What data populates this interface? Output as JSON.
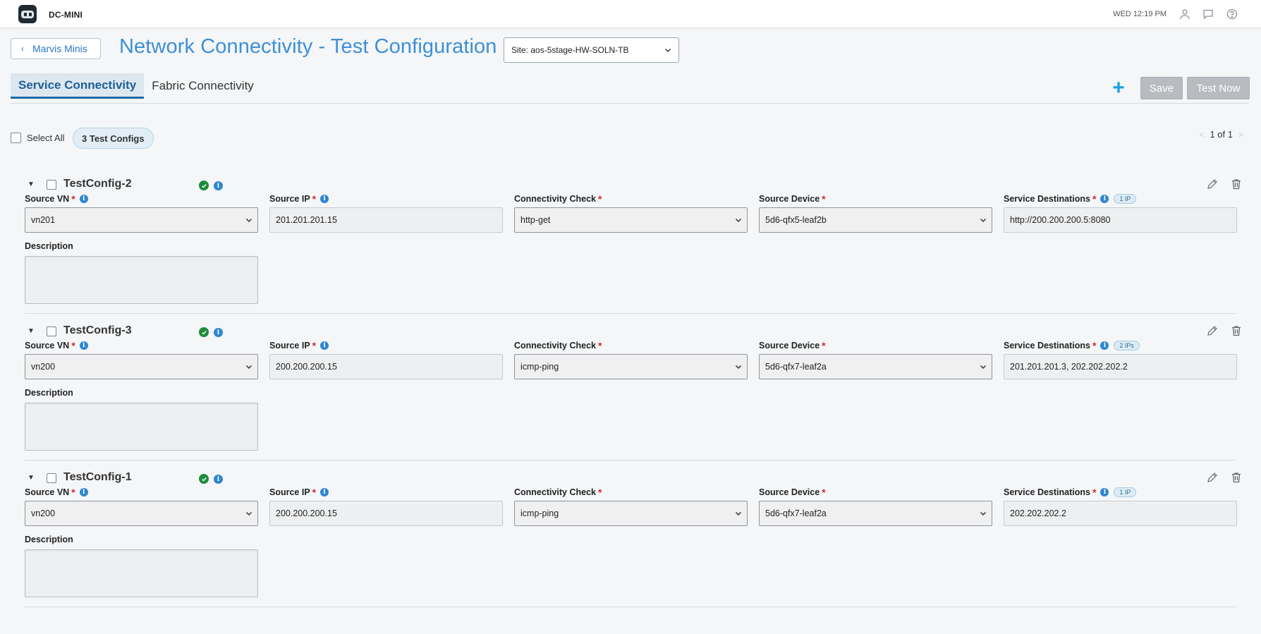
{
  "app": {
    "org_name": "DC-MINI",
    "clock": "WED 12:19 PM"
  },
  "header": {
    "back_label": "Marvis Minis",
    "title": "Network Connectivity - Test Configuration",
    "site_select": "Site: aos-5stage-HW-SOLN-TB"
  },
  "tabs": [
    {
      "label": "Service Connectivity",
      "active": true
    },
    {
      "label": "Fabric Connectivity",
      "active": false
    }
  ],
  "toolbar": {
    "save_label": "Save",
    "test_now_label": "Test Now",
    "add_symbol": "+"
  },
  "list": {
    "select_all_label": "Select All",
    "count_label": "3 Test Configs",
    "pager_text": "1 of 1"
  },
  "labels": {
    "source_vn": "Source VN",
    "source_ip": "Source IP",
    "connectivity_check": "Connectivity Check",
    "source_device": "Source Device",
    "service_destinations": "Service Destinations",
    "description": "Description",
    "required_mark": "*"
  },
  "configs": [
    {
      "name": "TestConfig-2",
      "source_vn": "vn201",
      "source_ip": "201.201.201.15",
      "check": "http-get",
      "device": "5d6-qfx5-leaf2b",
      "destinations": "http://200.200.200.5:8080",
      "ip_count": "1 IP",
      "description": ""
    },
    {
      "name": "TestConfig-3",
      "source_vn": "vn200",
      "source_ip": "200.200.200.15",
      "check": "icmp-ping",
      "device": "5d6-qfx7-leaf2a",
      "destinations": "201.201.201.3, 202.202.202.2",
      "ip_count": "2 IPs",
      "description": ""
    },
    {
      "name": "TestConfig-1",
      "source_vn": "vn200",
      "source_ip": "200.200.200.15",
      "check": "icmp-ping",
      "device": "5d6-qfx7-leaf2a",
      "destinations": "202.202.202.2",
      "ip_count": "1 IP",
      "description": ""
    }
  ],
  "icons": {
    "user": "user-icon",
    "chat": "chat-icon",
    "help": "help-icon",
    "status": "check-circle-icon",
    "info": "info-icon",
    "edit": "pencil-icon",
    "delete": "trash-icon"
  },
  "colors": {
    "accent": "#3d8fd6",
    "tab_active": "#1d5f98",
    "required": "#d62a2a",
    "ok": "#1f8c3c",
    "add": "#16a0e0"
  }
}
